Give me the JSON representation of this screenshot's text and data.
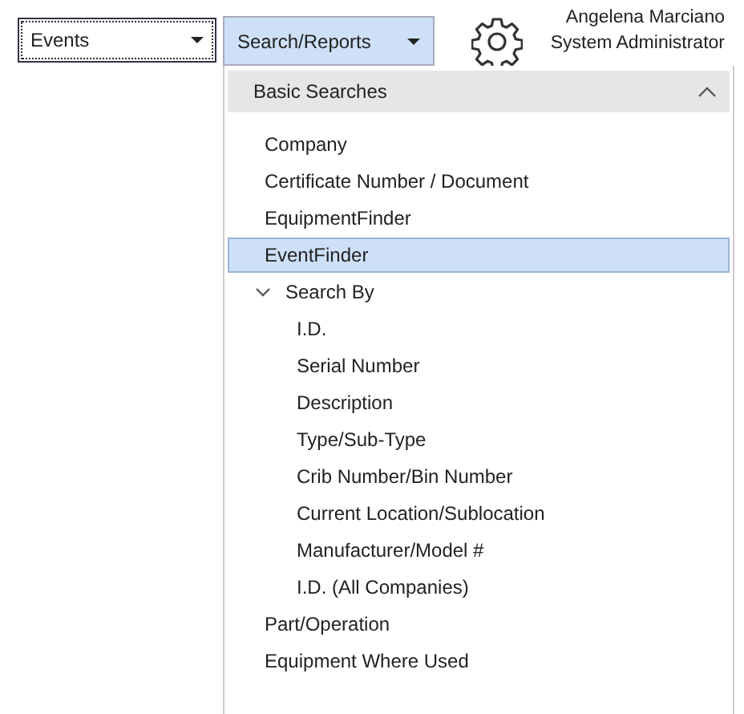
{
  "module_select": {
    "value": "Events"
  },
  "menu_button": {
    "label": "Search/Reports",
    "open": true
  },
  "user": {
    "name": "Angelena Marciano",
    "role": "System Administrator"
  },
  "menu": {
    "section": {
      "title": "Basic Searches",
      "expanded": true
    },
    "items": [
      {
        "kind": "item",
        "label": "Company",
        "selected": false
      },
      {
        "kind": "item",
        "label": "Certificate Number / Document",
        "selected": false
      },
      {
        "kind": "item",
        "label": "EquipmentFinder",
        "selected": false
      },
      {
        "kind": "item",
        "label": "EventFinder",
        "selected": true
      },
      {
        "kind": "group",
        "label": "Search By",
        "selected": false,
        "expanded": true,
        "children": [
          {
            "kind": "item",
            "label": "I.D.",
            "selected": false
          },
          {
            "kind": "item",
            "label": "Serial Number",
            "selected": false
          },
          {
            "kind": "item",
            "label": "Description",
            "selected": false
          },
          {
            "kind": "item",
            "label": "Type/Sub-Type",
            "selected": false
          },
          {
            "kind": "item",
            "label": "Crib Number/Bin Number",
            "selected": false
          },
          {
            "kind": "item",
            "label": "Current Location/Sublocation",
            "selected": false
          },
          {
            "kind": "item",
            "label": "Manufacturer/Model #",
            "selected": false
          },
          {
            "kind": "item",
            "label": "I.D. (All Companies)",
            "selected": false
          }
        ]
      },
      {
        "kind": "item",
        "label": "Part/Operation",
        "selected": false
      },
      {
        "kind": "item",
        "label": "Equipment Where Used",
        "selected": false
      }
    ]
  }
}
